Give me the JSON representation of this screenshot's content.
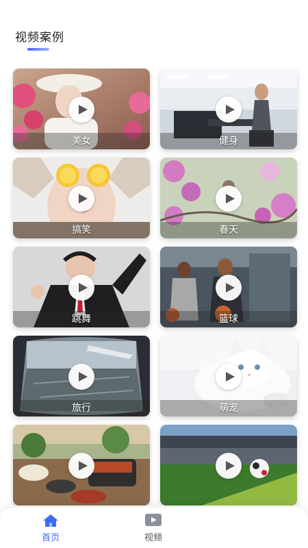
{
  "header": {
    "title": "视频案例"
  },
  "theme": {
    "accent": "#3d6bf2",
    "caption_bg": "rgba(40,40,40,0.35)"
  },
  "cards": [
    {
      "label": "美女",
      "icon": "play-icon"
    },
    {
      "label": "健身",
      "icon": "play-icon"
    },
    {
      "label": "搞笑",
      "icon": "play-icon"
    },
    {
      "label": "春天",
      "icon": "play-icon"
    },
    {
      "label": "跳舞",
      "icon": "play-icon"
    },
    {
      "label": "篮球",
      "icon": "play-icon"
    },
    {
      "label": "旅行",
      "icon": "play-icon"
    },
    {
      "label": "萌宠",
      "icon": "play-icon"
    },
    {
      "label": "",
      "icon": "play-icon"
    },
    {
      "label": "",
      "icon": "play-icon"
    }
  ],
  "tabbar": {
    "tabs": [
      {
        "label": "首页",
        "icon": "home-icon",
        "active": true
      },
      {
        "label": "视频",
        "icon": "video-icon",
        "active": false
      }
    ]
  }
}
